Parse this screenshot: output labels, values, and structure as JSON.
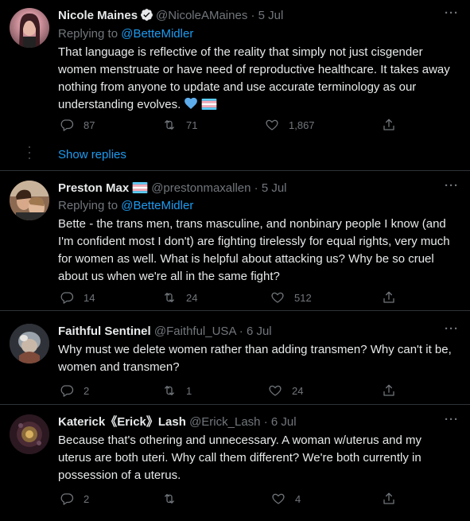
{
  "tweets": [
    {
      "name": "Nicole Maines",
      "handle": "@NicoleAMaines",
      "date": "· 5 Jul",
      "replying_prefix": "Replying to ",
      "replying_handle": "@BetteMidler",
      "text": "That language is reflective of the reality that simply not just cisgender women menstruate or have need of reproductive healthcare. It takes away nothing from anyone to update and use accurate terminology as our understanding evolves.",
      "replies": "87",
      "retweets": "71",
      "likes": "1,867",
      "verified": true
    },
    {
      "name": "Preston Max",
      "handle": "@prestonmaxallen",
      "date": "· 5 Jul",
      "replying_prefix": "Replying to ",
      "replying_handle": "@BetteMidler",
      "text": "Bette - the trans men, trans masculine, and nonbinary people I know (and I'm confident most I don't) are fighting tirelessly for equal rights, very much for women as well. What is helpful about attacking us? Why be so cruel about us when we're all in the same fight?",
      "replies": "14",
      "retweets": "24",
      "likes": "512"
    },
    {
      "name": "Faithful Sentinel",
      "handle": "@Faithful_USA",
      "date": "· 6 Jul",
      "text": "Why must we delete women rather than adding transmen? Why can't it be, women and transmen?",
      "replies": "2",
      "retweets": "1",
      "likes": "24"
    },
    {
      "name": "Katerick《Erick》Lash",
      "handle": "@Erick_Lash",
      "date": "· 6 Jul",
      "text": "Because that's othering and unnecessary. A woman w/uterus and my uterus are both uteri. Why call them different? We're both currently in possession of a uterus.",
      "replies": "2",
      "retweets": "",
      "likes": "4"
    }
  ],
  "show_replies": "Show replies",
  "more_label": "···",
  "icons": [
    "verified-badge-icon",
    "trans-flag-icon",
    "blue-heart-icon",
    "reply-icon",
    "retweet-icon",
    "like-icon",
    "share-icon",
    "more-icon"
  ],
  "colors": {
    "background": "#000000",
    "text": "#e7e9ea",
    "secondary": "#71767b",
    "link": "#1d9bf0",
    "divider": "#2f3336"
  }
}
